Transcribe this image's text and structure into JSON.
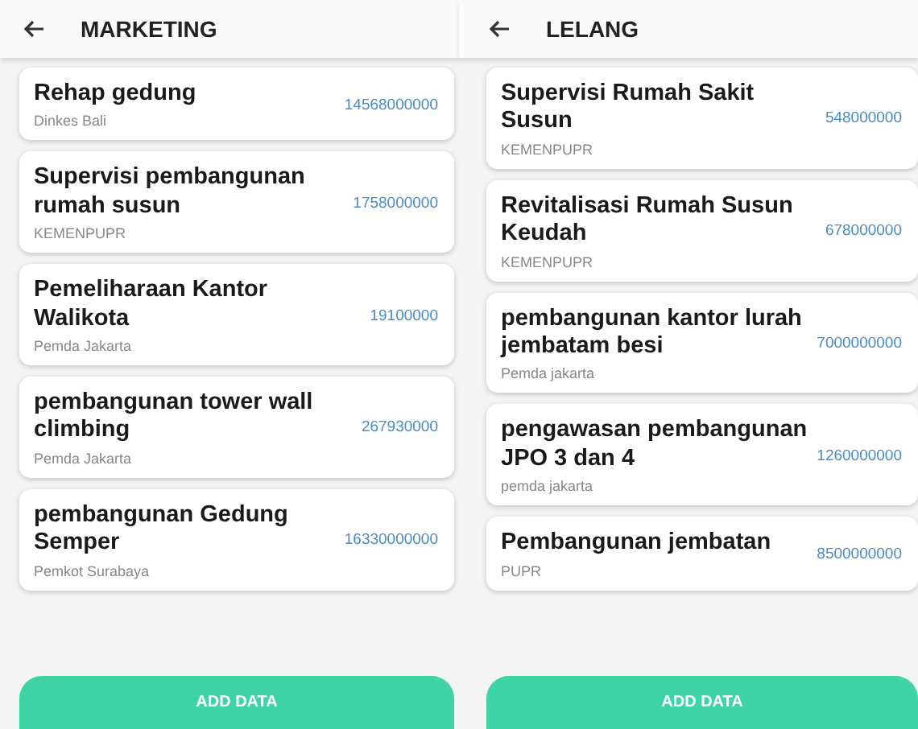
{
  "screens": [
    {
      "title": "MARKETING",
      "items": [
        {
          "name": "Rehap gedung",
          "agency": "Dinkes Bali",
          "amount": "14568000000"
        },
        {
          "name": "Supervisi pembangunan rumah susun",
          "agency": "KEMENPUPR",
          "amount": "1758000000"
        },
        {
          "name": "Pemeliharaan Kantor Walikota",
          "agency": "Pemda Jakarta",
          "amount": "19100000"
        },
        {
          "name": "pembangunan tower wall climbing",
          "agency": "Pemda Jakarta",
          "amount": "267930000"
        },
        {
          "name": "pembangunan Gedung Semper",
          "agency": "Pemkot Surabaya",
          "amount": "16330000000"
        }
      ],
      "button": "ADD DATA"
    },
    {
      "title": "LELANG",
      "items": [
        {
          "name": "Supervisi Rumah Sakit Susun",
          "agency": "KEMENPUPR",
          "amount": "548000000"
        },
        {
          "name": "Revitalisasi Rumah Susun Keudah",
          "agency": "KEMENPUPR",
          "amount": "678000000"
        },
        {
          "name": "pembangunan kantor lurah jembatam besi",
          "agency": "Pemda jakarta",
          "amount": "7000000000"
        },
        {
          "name": "pengawasan pembangunan JPO 3 dan 4",
          "agency": "pemda jakarta",
          "amount": "1260000000"
        },
        {
          "name": "Pembangunan jembatan",
          "agency": "PUPR",
          "amount": "8500000000"
        }
      ],
      "button": "ADD DATA"
    }
  ]
}
